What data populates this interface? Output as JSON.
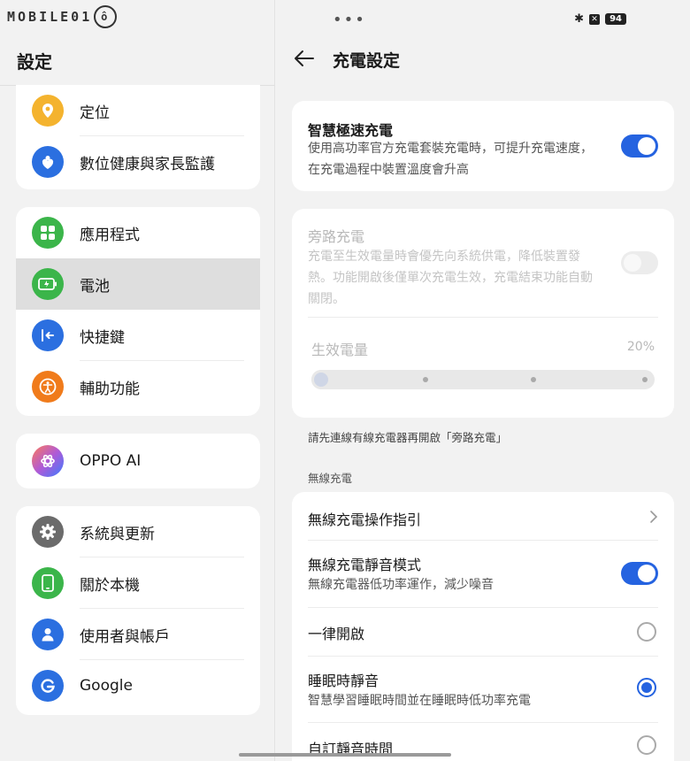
{
  "watermark": "MOBILE01",
  "left": {
    "title": "設定",
    "groups": [
      [
        {
          "label": "定位",
          "icon": "location-icon",
          "color": "#f4b32e"
        },
        {
          "label": "數位健康與家長監護",
          "icon": "heart-icon",
          "color": "#2b6fe0"
        }
      ],
      [
        {
          "label": "應用程式",
          "icon": "apps-icon",
          "color": "#3bb54a"
        },
        {
          "label": "電池",
          "icon": "battery-icon",
          "color": "#3bb54a"
        },
        {
          "label": "快捷鍵",
          "icon": "shortcut-icon",
          "color": "#2b6fe0"
        },
        {
          "label": "輔助功能",
          "icon": "accessibility-icon",
          "color": "#f07b1b"
        }
      ],
      [
        {
          "label": "OPPO AI",
          "icon": "ai-icon",
          "color": "#b05ad6"
        }
      ],
      [
        {
          "label": "系統與更新",
          "icon": "gear-icon",
          "color": "#6b6b6b"
        },
        {
          "label": "關於本機",
          "icon": "phone-icon",
          "color": "#3bb54a"
        },
        {
          "label": "使用者與帳戶",
          "icon": "user-icon",
          "color": "#2b6fe0"
        },
        {
          "label": "Google",
          "icon": "google-icon",
          "color": "#2b6fe0"
        }
      ]
    ]
  },
  "status": {
    "dots": "•••",
    "bluetooth": "✱",
    "battery": "94"
  },
  "right": {
    "title": "充電設定",
    "smart_charge": {
      "title": "智慧極速充電",
      "desc": "使用高功率官方充電套裝充電時，可提升充電速度，在充電過程中裝置溫度會升高",
      "enabled": true
    },
    "bypass": {
      "title": "旁路充電",
      "desc": "充電至生效電量時會優先向系統供電，降低裝置發熱。功能開啟後僅單次充電生效，充電結束功能自動關閉。",
      "enabled": false,
      "level_label": "生效電量",
      "level_value": "20%",
      "level_fraction": 0
    },
    "bypass_hint": "請先連線有線充電器再開啟「旁路充電」",
    "wireless_section": "無線充電",
    "wireless": {
      "guide": "無線充電操作指引",
      "silent_title": "無線充電靜音模式",
      "silent_desc": "無線充電器低功率運作，減少噪音",
      "silent_enabled": true,
      "options": [
        {
          "title": "一律開啟",
          "desc": "",
          "selected": false
        },
        {
          "title": "睡眠時靜音",
          "desc": "智慧學習睡眠時間並在睡眠時低功率充電",
          "selected": true
        },
        {
          "title": "自訂靜音時間",
          "desc": "",
          "selected": false
        }
      ]
    }
  }
}
